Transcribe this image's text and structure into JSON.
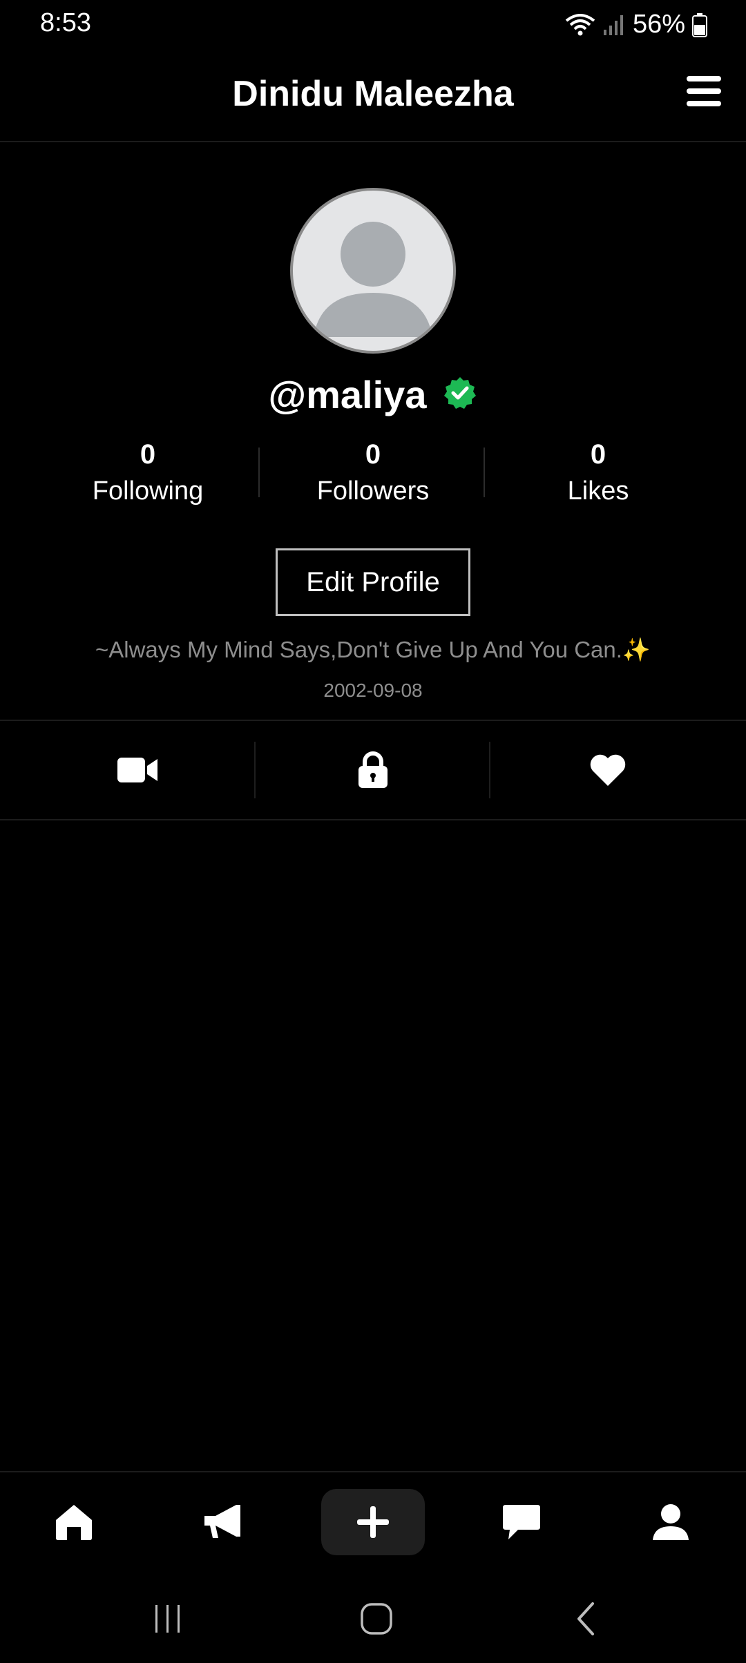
{
  "status_bar": {
    "time": "8:53",
    "battery_percent": "56%",
    "icons": [
      "wifi-icon",
      "signal-icon",
      "battery-icon"
    ]
  },
  "header": {
    "title": "Dinidu Maleezha",
    "menu_icon": "hamburger-menu-icon"
  },
  "profile": {
    "avatar_icon": "default-avatar-icon",
    "username": "@maliya",
    "verified_icon": "verified-badge-icon",
    "stats": [
      {
        "value": "0",
        "label": "Following"
      },
      {
        "value": "0",
        "label": "Followers"
      },
      {
        "value": "0",
        "label": "Likes"
      }
    ],
    "edit_button_label": "Edit Profile",
    "bio": "~Always My Mind Says,Don't Give Up And You Can.✨",
    "birthdate": "2002-09-08"
  },
  "tabs": [
    {
      "icon": "video-camera-icon",
      "active": true
    },
    {
      "icon": "lock-icon",
      "active": false
    },
    {
      "icon": "heart-icon",
      "active": false
    }
  ],
  "bottom_nav": [
    {
      "icon": "home-icon"
    },
    {
      "icon": "megaphone-icon"
    },
    {
      "icon": "plus-icon"
    },
    {
      "icon": "chat-bubble-icon"
    },
    {
      "icon": "user-icon"
    }
  ],
  "system_nav": [
    "recent-apps-icon",
    "home-circle-icon",
    "back-icon"
  ],
  "colors": {
    "background": "#000000",
    "verified": "#1db954",
    "muted_text": "#8e8e8e",
    "avatar_bg": "#e4e5e7",
    "avatar_figure": "#a9adb1"
  }
}
